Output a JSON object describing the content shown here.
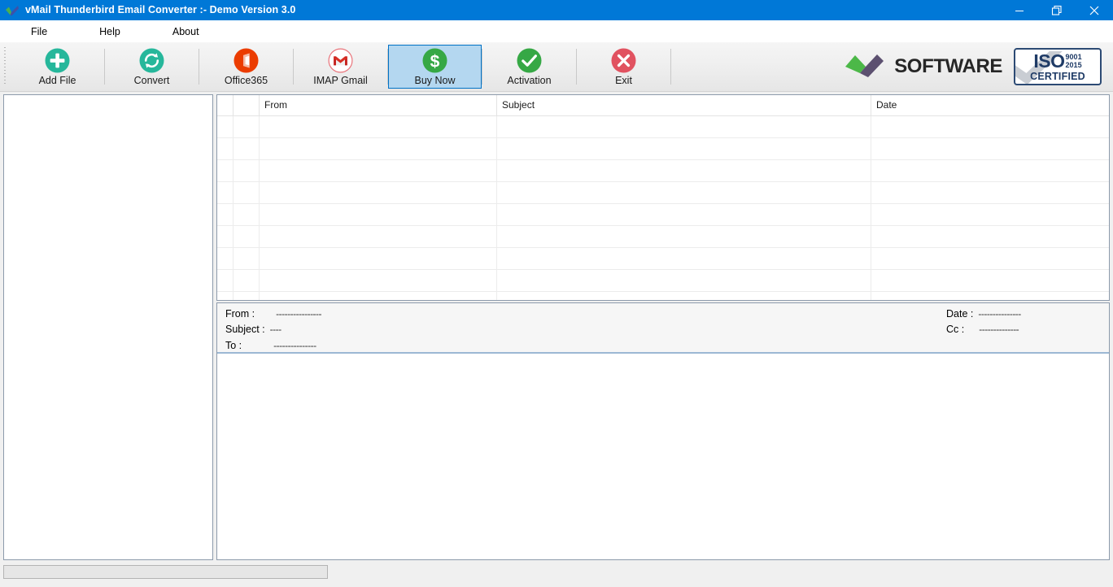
{
  "window": {
    "title": "vMail Thunderbird Email Converter  :- Demo Version 3.0",
    "app_icon": "check-mark-logo-icon",
    "titlebar_color": "#0078d7",
    "controls": {
      "minimize": "minimize-icon",
      "restore": "restore-icon",
      "close": "close-icon"
    }
  },
  "menubar": {
    "items": [
      {
        "label": "File"
      },
      {
        "label": "Help"
      },
      {
        "label": "About"
      }
    ]
  },
  "toolbar": {
    "grip": "toolbar-grip-handle",
    "buttons": [
      {
        "label": "Add File",
        "icon": "plus-circle-icon",
        "color": "#26b79b",
        "selected": false
      },
      {
        "label": "Convert",
        "icon": "refresh-circle-icon",
        "color": "#26b79b",
        "selected": false
      },
      {
        "label": "Office365",
        "icon": "office365-icon",
        "color": "#eb3c00",
        "selected": false
      },
      {
        "label": "IMAP Gmail",
        "icon": "gmail-icon",
        "color": "#d93025",
        "selected": false
      },
      {
        "label": "Buy Now",
        "icon": "dollar-circle-icon",
        "color": "#36a845",
        "selected": true
      },
      {
        "label": "Activation",
        "icon": "check-circle-icon",
        "color": "#36a845",
        "selected": false
      },
      {
        "label": "Exit",
        "icon": "close-circle-icon",
        "color": "#e15260",
        "selected": false
      }
    ],
    "selected_bg": "#b4d7f0",
    "selected_border": "#0072c6"
  },
  "brand": {
    "software_text": "SOFTWARE",
    "software_logo_icon": "green-purple-check-logo-icon",
    "iso": {
      "main": "ISO",
      "standard_line1": "9001",
      "standard_line2": "2015",
      "certified": "CERTIFIED",
      "watermark_icon": "grey-check-icon",
      "color": "#1f3b66"
    }
  },
  "mail_list": {
    "columns": [
      "",
      "",
      "From",
      "Subject",
      "Date"
    ],
    "rows": [],
    "empty_row_count": 9
  },
  "preview": {
    "fields": [
      {
        "label": "From :",
        "value": "----------------"
      },
      {
        "label": "Subject :",
        "value": "----"
      },
      {
        "label": "To :",
        "value": "---------------"
      },
      {
        "label": "Date :",
        "value": "---------------"
      },
      {
        "label": "Cc :",
        "value": "--------------"
      }
    ],
    "body": ""
  },
  "statusbar": {
    "progress_percent": 0,
    "progress_text": ""
  }
}
